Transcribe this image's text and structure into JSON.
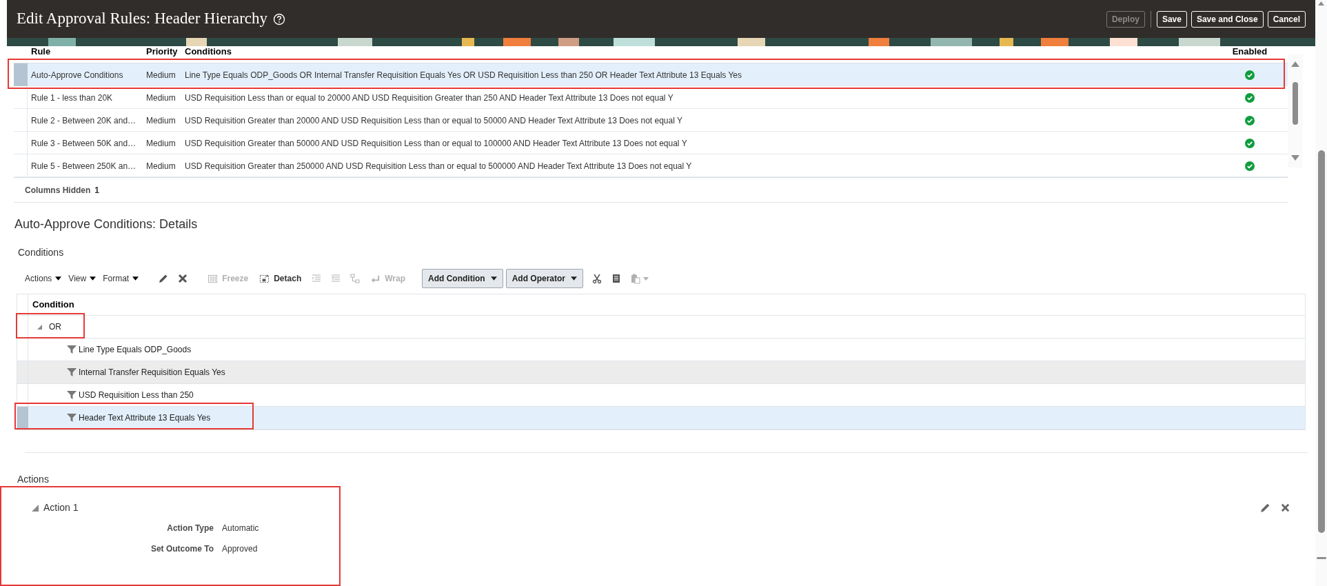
{
  "header": {
    "title": "Edit Approval Rules: Header Hierarchy",
    "buttons": [
      {
        "label": "Deploy",
        "disabled": true
      },
      {
        "label": "Save",
        "disabled": false
      },
      {
        "label": "Save and Close",
        "disabled": false
      },
      {
        "label": "Cancel",
        "disabled": false
      }
    ]
  },
  "rules_table": {
    "columns": [
      "Rule",
      "Priority",
      "Conditions",
      "Enabled"
    ],
    "rows": [
      {
        "rule": "Auto-Approve Conditions",
        "priority": "Medium",
        "conditions": "Line Type Equals ODP_Goods OR Internal Transfer Requisition Equals Yes OR USD Requisition Less than 250 OR Header Text Attribute 13 Equals Yes",
        "enabled": true,
        "selected": true
      },
      {
        "rule": "Rule 1 - less than 20K",
        "priority": "Medium",
        "conditions": "USD Requisition Less than or equal to 20000 AND USD Requisition Greater than 250 AND Header Text Attribute 13 Does not equal Y",
        "enabled": true,
        "selected": false
      },
      {
        "rule": "Rule 2 - Between 20K and…",
        "priority": "Medium",
        "conditions": "USD Requisition Greater than 20000 AND USD Requisition Less than or equal to 50000 AND Header Text Attribute 13 Does not equal Y",
        "enabled": true,
        "selected": false
      },
      {
        "rule": "Rule 3 - Between 50K and…",
        "priority": "Medium",
        "conditions": "USD Requisition Greater than 50000 AND USD Requisition Less than or equal to 100000 AND Header Text Attribute 13 Does not equal Y",
        "enabled": true,
        "selected": false
      },
      {
        "rule": "Rule 5 - Between 250K an…",
        "priority": "Medium",
        "conditions": "USD Requisition Greater than 250000 AND USD Requisition Less than or equal to 500000 AND Header Text Attribute 13 Does not equal Y",
        "enabled": true,
        "selected": false
      }
    ],
    "columns_hidden_label": "Columns Hidden",
    "columns_hidden_count": "1"
  },
  "details": {
    "title": "Auto-Approve Conditions: Details",
    "conditions_label": "Conditions",
    "toolbar": [
      {
        "kind": "menu",
        "label": "Actions"
      },
      {
        "kind": "menu",
        "label": "View"
      },
      {
        "kind": "menu",
        "label": "Format"
      },
      {
        "kind": "icon",
        "disabled": false
      },
      {
        "kind": "icon",
        "disabled": false
      },
      {
        "kind": "labeled",
        "label": "Freeze",
        "disabled": true
      },
      {
        "kind": "labeled",
        "label": "Detach",
        "disabled": false
      },
      {
        "kind": "icon",
        "disabled": true
      },
      {
        "kind": "icon",
        "disabled": true
      },
      {
        "kind": "icon",
        "disabled": true
      },
      {
        "kind": "labeled",
        "label": "Wrap",
        "disabled": true
      },
      {
        "kind": "dropdown",
        "label": "Add Condition",
        "disabled": false
      },
      {
        "kind": "dropdown",
        "label": "Add Operator",
        "disabled": false
      },
      {
        "kind": "icon",
        "disabled": false
      },
      {
        "kind": "icon",
        "disabled": false
      },
      {
        "kind": "icon",
        "disabled": true
      }
    ],
    "tree": {
      "column": "Condition",
      "root": {
        "label": "OR",
        "expanded": true,
        "selected": false,
        "children": [
          {
            "label": "Line Type Equals ODP_Goods",
            "selected": false,
            "hovered": false
          },
          {
            "label": "Internal Transfer Requisition Equals Yes",
            "selected": false,
            "hovered": true
          },
          {
            "label": "USD Requisition Less than 250",
            "selected": false,
            "hovered": false
          },
          {
            "label": "Header Text Attribute 13 Equals Yes",
            "selected": true,
            "hovered": false
          }
        ]
      }
    }
  },
  "actions": {
    "title": "Actions",
    "items": [
      {
        "title": "Action 1",
        "expanded": true,
        "fields": [
          {
            "label": "Action Type",
            "value": "Automatic"
          },
          {
            "label": "Set Outcome To",
            "value": "Approved"
          }
        ]
      }
    ]
  }
}
